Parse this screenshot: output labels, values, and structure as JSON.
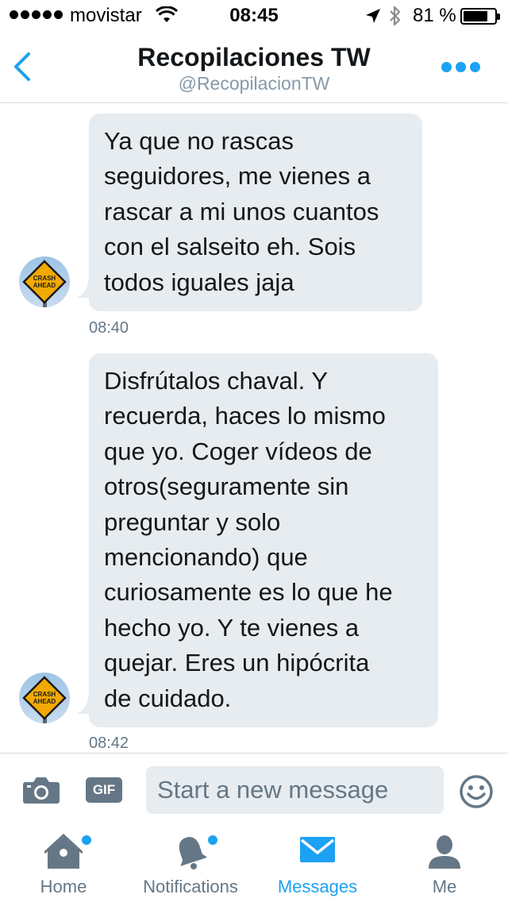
{
  "status_bar": {
    "carrier": "movistar",
    "time": "08:45",
    "battery_percent": "81 %",
    "battery_level": 0.81
  },
  "header": {
    "title": "Recopilaciones TW",
    "handle": "@RecopilacionTW"
  },
  "messages": [
    {
      "sender": "other",
      "lines": [
        "Ya que no rascas",
        "seguidores, me vienes a",
        "rascar a mi unos cuantos",
        "con el salseito eh. Sois",
        "todos iguales jaja"
      ],
      "time": "08:40",
      "avatar_icon": "crash-ahead-sign-avatar",
      "avatar_text": [
        "CRASH",
        "AHEAD"
      ]
    },
    {
      "sender": "other",
      "lines": [
        "Disfrútalos chaval. Y",
        "recuerda, haces lo mismo",
        "que yo. Coger vídeos de",
        "otros(seguramente sin",
        "preguntar y solo",
        "mencionando) que",
        "curiosamente es lo que he",
        "hecho yo. Y te vienes a",
        "quejar. Eres un hipócrita",
        "de cuidado."
      ],
      "time": "08:42",
      "avatar_icon": "crash-ahead-sign-avatar",
      "avatar_text": [
        "CRASH",
        "AHEAD"
      ]
    }
  ],
  "composer": {
    "placeholder": "Start a new message",
    "gif_label": "GIF"
  },
  "tabs": [
    {
      "label": "Home",
      "icon": "home-icon",
      "active": false,
      "notification_dot": true
    },
    {
      "label": "Notifications",
      "icon": "bell-icon",
      "active": false,
      "notification_dot": true
    },
    {
      "label": "Messages",
      "icon": "envelope-icon",
      "active": true,
      "notification_dot": false
    },
    {
      "label": "Me",
      "icon": "person-icon",
      "active": false,
      "notification_dot": false
    }
  ],
  "colors": {
    "accent": "#1da1f2",
    "bubble": "#e6ecf0",
    "muted": "#657786",
    "text": "#14171a"
  }
}
